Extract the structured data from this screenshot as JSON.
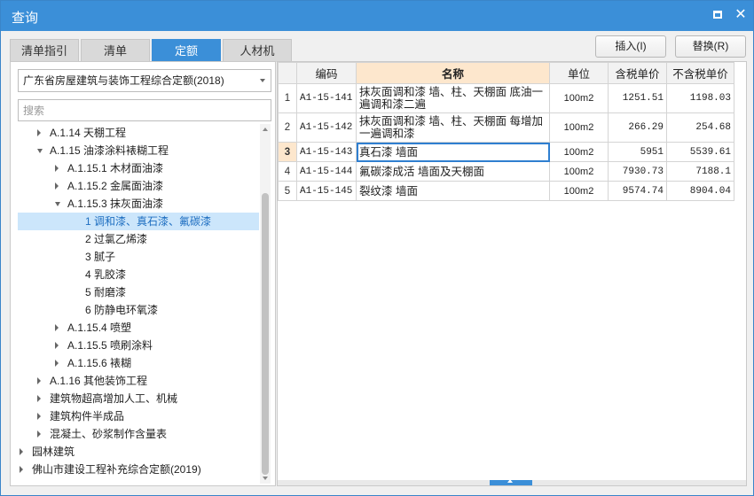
{
  "window": {
    "title": "查询"
  },
  "tabs": [
    {
      "label": "清单指引",
      "active": false
    },
    {
      "label": "清单",
      "active": false
    },
    {
      "label": "定额",
      "active": true
    },
    {
      "label": "人材机",
      "active": false
    }
  ],
  "actions": {
    "insert_label": "插入(I)",
    "replace_label": "替换(R)"
  },
  "left": {
    "quota_library": "广东省房屋建筑与装饰工程综合定额(2018)",
    "search_placeholder": "搜索",
    "tree": [
      {
        "label": "A.1.14 天棚工程",
        "level": 1,
        "state": "collapsed"
      },
      {
        "label": "A.1.15 油漆涂料裱糊工程",
        "level": 1,
        "state": "expanded"
      },
      {
        "label": "A.1.15.1 木材面油漆",
        "level": 2,
        "state": "collapsed"
      },
      {
        "label": "A.1.15.2 金属面油漆",
        "level": 2,
        "state": "collapsed"
      },
      {
        "label": "A.1.15.3 抹灰面油漆",
        "level": 2,
        "state": "expanded"
      },
      {
        "label": "1 调和漆、真石漆、氟碳漆",
        "level": 3,
        "state": "leaf",
        "selected": true
      },
      {
        "label": "2 过氯乙烯漆",
        "level": 3,
        "state": "leaf"
      },
      {
        "label": "3 腻子",
        "level": 3,
        "state": "leaf"
      },
      {
        "label": "4 乳胶漆",
        "level": 3,
        "state": "leaf"
      },
      {
        "label": "5 耐磨漆",
        "level": 3,
        "state": "leaf"
      },
      {
        "label": "6 防静电环氧漆",
        "level": 3,
        "state": "leaf"
      },
      {
        "label": "A.1.15.4 喷塑",
        "level": 2,
        "state": "collapsed"
      },
      {
        "label": "A.1.15.5 喷刷涂料",
        "level": 2,
        "state": "collapsed"
      },
      {
        "label": "A.1.15.6 裱糊",
        "level": 2,
        "state": "collapsed"
      },
      {
        "label": "A.1.16 其他装饰工程",
        "level": 1,
        "state": "collapsed"
      },
      {
        "label": "建筑物超高增加人工、机械",
        "level": 1,
        "state": "collapsed"
      },
      {
        "label": "建筑构件半成品",
        "level": 1,
        "state": "collapsed"
      },
      {
        "label": "混凝土、砂浆制作含量表",
        "level": 1,
        "state": "collapsed"
      },
      {
        "label": "园林建筑",
        "level": 0,
        "state": "collapsed"
      },
      {
        "label": "佛山市建设工程补充综合定额(2019)",
        "level": 0,
        "state": "collapsed"
      }
    ]
  },
  "table": {
    "columns": [
      "",
      "编码",
      "名称",
      "单位",
      "含税单价",
      "不含税单价"
    ],
    "rows": [
      {
        "no": "1",
        "code": "A1-15-141",
        "name": "抹灰面调和漆 墙、柱、天棚面 底油一遍调和漆二遍",
        "unit": "100m2",
        "price_tax": "1251.51",
        "price_notax": "1198.03"
      },
      {
        "no": "2",
        "code": "A1-15-142",
        "name": "抹灰面调和漆 墙、柱、天棚面 每增加一遍调和漆",
        "unit": "100m2",
        "price_tax": "266.29",
        "price_notax": "254.68"
      },
      {
        "no": "3",
        "code": "A1-15-143",
        "name": "真石漆 墙面",
        "unit": "100m2",
        "price_tax": "5951",
        "price_notax": "5539.61",
        "current": true
      },
      {
        "no": "4",
        "code": "A1-15-144",
        "name": "氟碳漆成活 墙面及天棚面",
        "unit": "100m2",
        "price_tax": "7930.73",
        "price_notax": "7188.1"
      },
      {
        "no": "5",
        "code": "A1-15-145",
        "name": "裂纹漆 墙面",
        "unit": "100m2",
        "price_tax": "9574.74",
        "price_notax": "8904.04"
      }
    ]
  }
}
